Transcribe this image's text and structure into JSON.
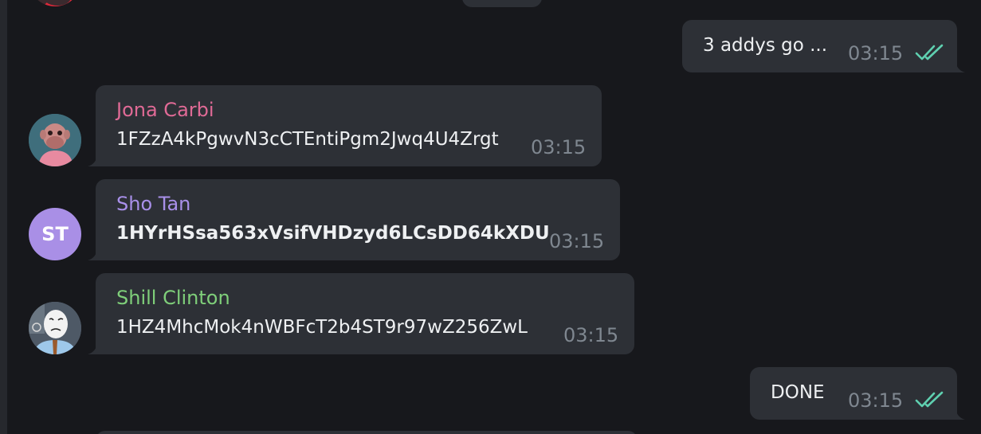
{
  "colors": {
    "background": "#17181c",
    "bubble": "#2d3036",
    "timestamp": "#7f8790",
    "read_ticks": "#5fd0b0"
  },
  "top_outgoing": {
    "text": "3 addys go ...",
    "time": "03:15",
    "status_icon": "double-check-icon"
  },
  "messages": [
    {
      "sender": "Jona Carbi",
      "sender_color": "#e06a96",
      "text": "1FZzA4kPgwvN3cCTEntiPgm2Jwq4U4Zrgt",
      "time": "03:15",
      "avatar": "ape-avatar-icon"
    },
    {
      "sender": "Sho Tan",
      "sender_color": "#a990ea",
      "text": "1HYrHSsa563xVsifVHDzyd6LCsDD64kXDU",
      "time": "03:15",
      "avatar_initials": "ST",
      "avatar_color": "#a98fe6"
    },
    {
      "sender": "Shill Clinton",
      "sender_color": "#7fcf7a",
      "text": "1HZ4MhcMok4nWBFcT2b4ST9r97wZ256ZwL",
      "time": "03:15",
      "avatar": "wojak-avatar-icon"
    }
  ],
  "bottom_outgoing": {
    "text": "DONE",
    "time": "03:15",
    "status_icon": "double-check-icon"
  }
}
